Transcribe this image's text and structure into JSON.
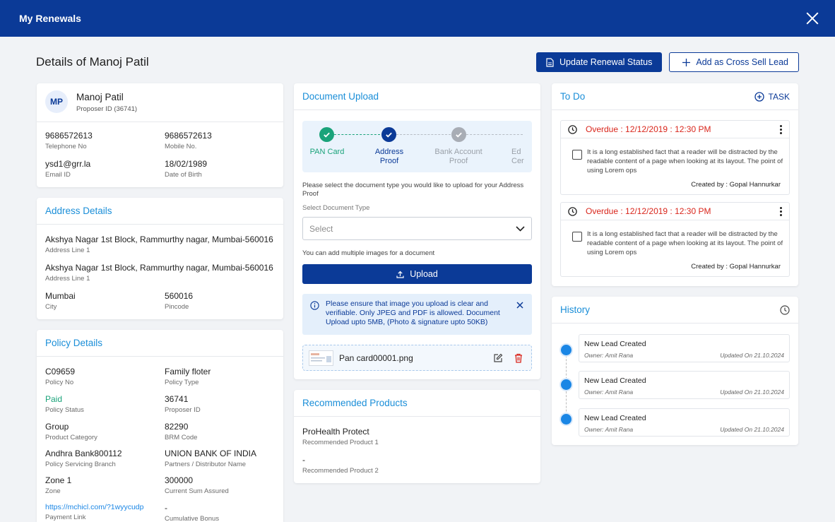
{
  "window": {
    "title": "My Renewals"
  },
  "page": {
    "title": "Details of Manoj Patil",
    "update_status_label": "Update Renewal Status",
    "cross_sell_label": "Add as Cross Sell Lead"
  },
  "colors": {
    "primary": "#0b3a97",
    "accent": "#1a8ed8",
    "success": "#1aa37a",
    "danger": "#d9261c"
  },
  "profile": {
    "initials": "MP",
    "name": "Manoj Patil",
    "proposer_id": "Proposer ID (36741)",
    "telephone": {
      "value": "9686572613",
      "label": "Telephone No"
    },
    "mobile": {
      "value": "9686572613",
      "label": "Mobile No."
    },
    "email": {
      "value": "ysd1@grr.la",
      "label": "Email ID"
    },
    "dob": {
      "value": "18/02/1989",
      "label": "Date of Birth"
    }
  },
  "address": {
    "title": "Address Details",
    "line1": {
      "value": "Akshya Nagar 1st Block, Rammurthy nagar, Mumbai-560016",
      "label": "Address Line 1"
    },
    "line2": {
      "value": "Akshya Nagar 1st Block, Rammurthy nagar, Mumbai-560016",
      "label": "Address Line 1"
    },
    "city": {
      "value": "Mumbai",
      "label": "City"
    },
    "pincode": {
      "value": "560016",
      "label": "Pincode"
    }
  },
  "policy": {
    "title": "Policy Details",
    "policy_no": {
      "value": "C09659",
      "label": "Policy No"
    },
    "policy_type": {
      "value": "Family floter",
      "label": "Policy Type"
    },
    "status": {
      "value": "Paid",
      "label": "Policy Status"
    },
    "proposer_id": {
      "value": "36741",
      "label": "Proposer ID"
    },
    "category": {
      "value": "Group",
      "label": "Product Category"
    },
    "brm_code": {
      "value": "82290",
      "label": "BRM Code"
    },
    "branch": {
      "value": "Andhra Bank800112",
      "label": "Policy Servicing Branch"
    },
    "partner": {
      "value": "UNION BANK OF INDIA",
      "label": "Partners / Distributor Name"
    },
    "zone": {
      "value": "Zone 1",
      "label": "Zone"
    },
    "sum_assured": {
      "value": "300000",
      "label": "Current Sum Assured"
    },
    "payment_link": {
      "value": "https://mchicl.com/?1wyycudp",
      "label": "Payment Link"
    },
    "bonus": {
      "value": "-",
      "label": "Cumulative Bonus"
    }
  },
  "document": {
    "title": "Document Upload",
    "steps": [
      {
        "label": "PAN Card",
        "state": "done"
      },
      {
        "label": "Address Proof",
        "state": "current"
      },
      {
        "label": "Bank Account Proof",
        "state": "pending"
      },
      {
        "label": "Ed Cer",
        "state": "pending"
      }
    ],
    "instruction": "Please select the document type you would like to upload for your Address Proof",
    "select_label": "Select Document Type",
    "select_value": "Select",
    "multi_hint": "You can add multiple images for a document",
    "upload_label": "Upload",
    "info_text": "Please ensure that image you upload is clear and verifiable. Only JPEG and PDF is allowed. Document Upload upto 5MB, (Photo & signature upto 50KB)",
    "file_name": "Pan card00001.png"
  },
  "recommended": {
    "title": "Recommended Products",
    "items": [
      {
        "value": "ProHealth Protect",
        "label": "Recommended Product 1"
      },
      {
        "value": "-",
        "label": "Recommended Product 2"
      }
    ]
  },
  "todo": {
    "title": "To Do",
    "add_label": "TASK",
    "items": [
      {
        "overdue": "Overdue : 12/12/2019 : 12:30 PM",
        "text": "It is a long established fact that a reader will be distracted by the readable content of a page when looking at its layout.  The point of using Lorem ops",
        "created_by": "Created by : Gopal Hannurkar"
      },
      {
        "overdue": "Overdue : 12/12/2019 : 12:30 PM",
        "text": "It is a long established fact that a reader will be distracted by the readable content of a page when looking at its layout.  The point of using Lorem ops",
        "created_by": "Created by : Gopal Hannurkar"
      }
    ]
  },
  "history": {
    "title": "History",
    "items": [
      {
        "title": "New Lead Created",
        "owner": "Owner: Amit Rana",
        "updated": "Updated On 21.10.2024"
      },
      {
        "title": "New Lead Created",
        "owner": "Owner: Amit Rana",
        "updated": "Updated On 21.10.2024"
      },
      {
        "title": "New Lead Created",
        "owner": "Owner: Amit Rana",
        "updated": "Updated On 21.10.2024"
      }
    ]
  }
}
